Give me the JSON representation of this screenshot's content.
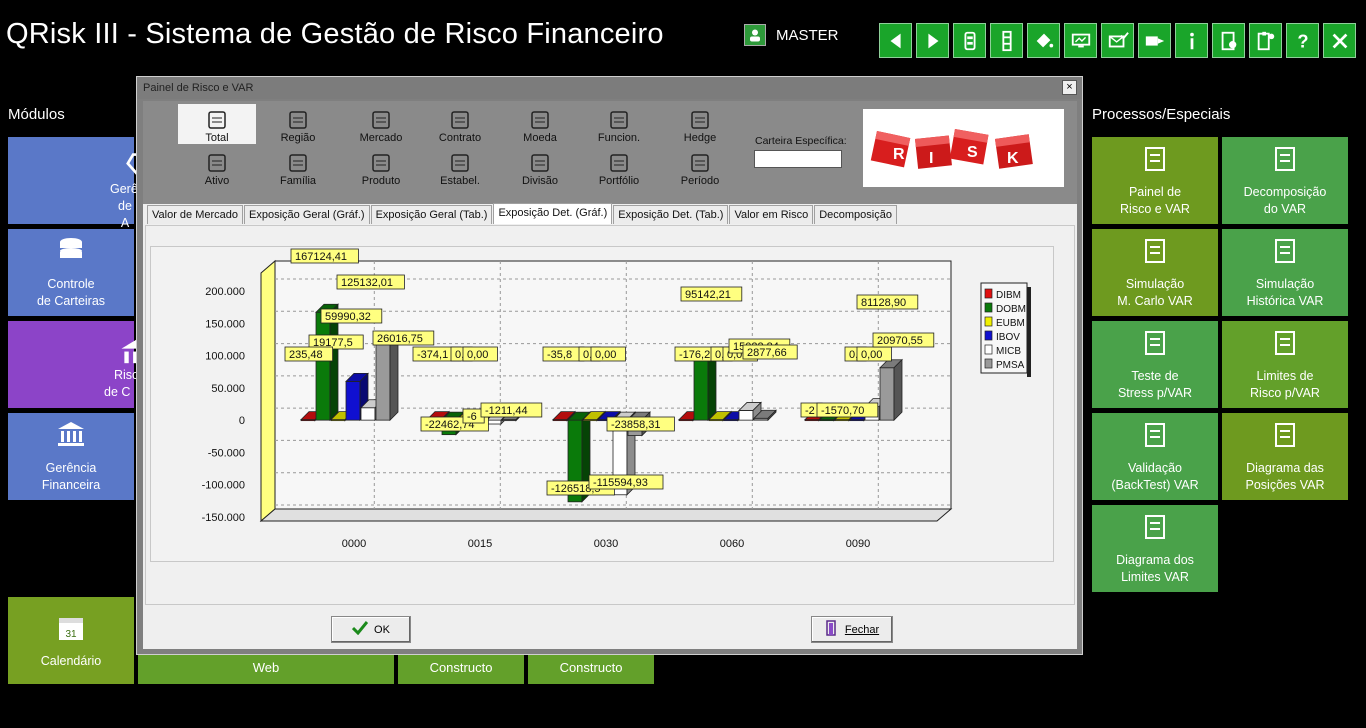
{
  "app": {
    "title": "QRisk III - Sistema de Gestão de Risco Financeiro",
    "user": "MASTER"
  },
  "toolbar": [
    "back-icon",
    "forward-icon",
    "film-icon",
    "film-strip-icon",
    "paint-bucket-icon",
    "monitor-icon",
    "mail-check-icon",
    "mail-forward-icon",
    "info-icon",
    "document-settings-icon",
    "document-clipboard-icon",
    "help-icon",
    "close-icon"
  ],
  "left": {
    "header": "Módulos",
    "tiles": [
      {
        "label1": "Gerê",
        "label2": "de A"
      },
      {
        "label1": "Controle",
        "label2": "de Carteiras"
      },
      {
        "label1": "Risc",
        "label2": "de  C"
      },
      {
        "label1": "Gerência",
        "label2": "Financeira"
      },
      {
        "label1": "Calendário",
        "label2": ""
      }
    ],
    "bottom": [
      "Web",
      "Constructo",
      "Constructo"
    ]
  },
  "right": {
    "header": "Processos/Especiais",
    "tiles": [
      {
        "label1": "Painel de",
        "label2": "Risco e VAR"
      },
      {
        "label1": "Decomposição",
        "label2": "do VAR"
      },
      {
        "label1": "Simulação",
        "label2": "M. Carlo VAR"
      },
      {
        "label1": "Simulação",
        "label2": "Histórica VAR"
      },
      {
        "label1": "Teste de",
        "label2": "Stress p/VAR"
      },
      {
        "label1": "Limites de",
        "label2": "Risco p/VAR"
      },
      {
        "label1": "Validação",
        "label2": "(BackTest) VAR"
      },
      {
        "label1": "Diagrama das",
        "label2": "Posições VAR"
      },
      {
        "label1": "Diagrama dos",
        "label2": "Limites VAR"
      }
    ]
  },
  "dialog": {
    "title": "Painel de Risco e VAR",
    "close": "×",
    "filters_row1": [
      "Total",
      "Região",
      "Mercado",
      "Contrato",
      "Moeda",
      "Funcion.",
      "Hedge"
    ],
    "filters_row2": [
      "Ativo",
      "Família",
      "Produto",
      "Estabel.",
      "Divisão",
      "Portfólio",
      "Período"
    ],
    "carteira_label": "Carteira Específica:",
    "risk_image_letters": [
      "R",
      "I",
      "S",
      "K"
    ],
    "tabs": [
      "Valor de Mercado",
      "Exposição Geral (Gráf.)",
      "Exposição Geral (Tab.)",
      "Exposição Det. (Gráf.)",
      "Exposição Det. (Tab.)",
      "Valor em Risco",
      "Decomposição"
    ],
    "active_tab": 3,
    "ok": "OK",
    "fechar": "Fechar"
  },
  "chart_data": {
    "type": "bar",
    "categories": [
      "0000",
      "0015",
      "0030",
      "0060",
      "0090"
    ],
    "ylim": [
      -150000,
      200000
    ],
    "yticks": [
      "200.000",
      "150.000",
      "100.000",
      "50.000",
      "0",
      "-50.000",
      "-100.000",
      "-150.000"
    ],
    "legend_position": "right",
    "series": [
      {
        "name": "DIBM",
        "color": "#e01010",
        "values": [
          0,
          0,
          0,
          0,
          0
        ]
      },
      {
        "name": "DOBM",
        "color": "#0a7a0a",
        "values": [
          167124.41,
          -22462.74,
          -126518.54,
          95142.21,
          0
        ]
      },
      {
        "name": "EUBM",
        "color": "#f0f000",
        "values": [
          235.48,
          0,
          0,
          0,
          0
        ]
      },
      {
        "name": "IBOV",
        "color": "#1010d0",
        "values": [
          59990.32,
          0,
          0,
          0,
          0
        ]
      },
      {
        "name": "MICB",
        "color": "#ffffff",
        "values": [
          19177.5,
          -6000,
          -115594.93,
          15022.84,
          20970.55
        ]
      },
      {
        "name": "PMSA",
        "color": "#9a9a9a",
        "values": [
          125132.01,
          -1211.44,
          -23858.31,
          2877.66,
          81128.9
        ]
      }
    ],
    "data_labels": [
      {
        "text": "167124,41"
      },
      {
        "text": "125132,01"
      },
      {
        "text": "59990,32"
      },
      {
        "text": "19177,5"
      },
      {
        "text": "26016,75"
      },
      {
        "text": "235,48"
      },
      {
        "text": "-374,1"
      },
      {
        "text": "0,"
      },
      {
        "text": "0,00"
      },
      {
        "text": "-22462,74"
      },
      {
        "text": "-6"
      },
      {
        "text": "-1211,44"
      },
      {
        "text": "-35,8"
      },
      {
        "text": "0,"
      },
      {
        "text": "0,00"
      },
      {
        "text": "-23858,31"
      },
      {
        "text": "-126518,5"
      },
      {
        "text": "-115594,93"
      },
      {
        "text": "95142,21"
      },
      {
        "text": "-176,2"
      },
      {
        "text": "0,"
      },
      {
        "text": "0,00"
      },
      {
        "text": "15022,84"
      },
      {
        "text": "2877,66"
      },
      {
        "text": "81128,90"
      },
      {
        "text": "0,"
      },
      {
        "text": "0,00"
      },
      {
        "text": "20970,55"
      },
      {
        "text": "-2"
      },
      {
        "text": "-1570,70"
      }
    ]
  }
}
